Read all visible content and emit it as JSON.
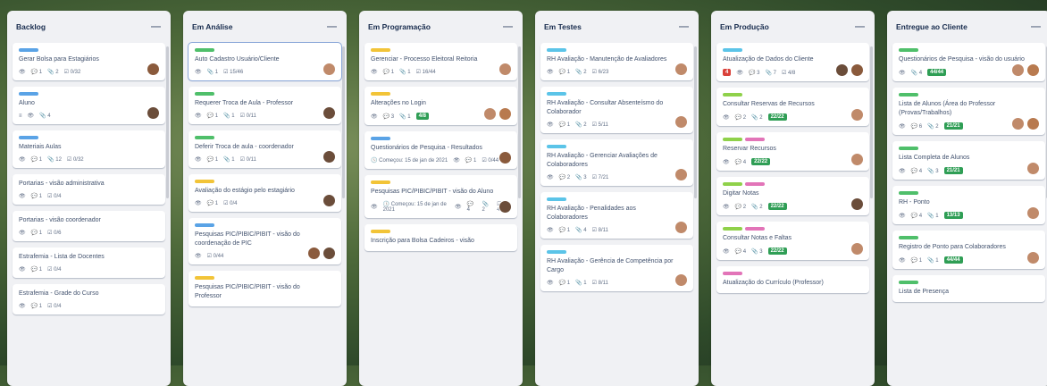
{
  "colors": {
    "blue": "#5aa3e6",
    "green": "#4fbf6a",
    "yellow": "#f2c438",
    "pink": "#e274b8",
    "sky": "#5bc4e8",
    "lime": "#8fd14a"
  },
  "columns": [
    {
      "title": "Backlog",
      "cards": [
        {
          "labels": [
            "blue"
          ],
          "title": "Gerar Bolsa para Estagiários",
          "badges": [
            "👁",
            "💬 1",
            "📎 2",
            "☑ 0/32"
          ],
          "avatars": [
            "a"
          ]
        },
        {
          "labels": [
            "blue"
          ],
          "title": "Aluno",
          "badges": [
            "≡",
            "👁",
            "📎 4"
          ],
          "avatars": [
            "c"
          ]
        },
        {
          "labels": [
            "blue"
          ],
          "title": "Materiais Aulas",
          "badges": [
            "👁",
            "💬 1",
            "📎 12",
            "☑ 0/32"
          ],
          "avatars": []
        },
        {
          "labels": [],
          "title": "Portarias - visão administrativa",
          "badges": [
            "👁",
            "💬 1",
            "☑ 0/4"
          ],
          "avatars": []
        },
        {
          "labels": [],
          "title": "Portarias - visão coordenador",
          "badges": [
            "👁",
            "💬 1",
            "☑ 0/6"
          ],
          "avatars": []
        },
        {
          "labels": [],
          "title": "Estrafemia - Lista de Docentes",
          "badges": [
            "👁",
            "💬 1",
            "☑ 0/4"
          ],
          "avatars": []
        },
        {
          "labels": [],
          "title": "Estrafemia - Grade do Curso",
          "badges": [
            "👁",
            "💬 1",
            "☑ 0/4"
          ],
          "avatars": []
        }
      ]
    },
    {
      "title": "Em Análise",
      "cards": [
        {
          "labels": [
            "green"
          ],
          "title": "Auto Cadastro Usuário/Cliente",
          "badges": [
            "👁",
            "📎 1",
            "☑ 15/46"
          ],
          "avatars": [
            "d"
          ],
          "sel": true
        },
        {
          "labels": [
            "green"
          ],
          "title": "Requerer Troca de Aula - Professor",
          "badges": [
            "👁",
            "💬 1",
            "📎 1",
            "☑ 0/11"
          ],
          "avatars": [
            "c"
          ]
        },
        {
          "labels": [
            "green"
          ],
          "title": "Deferir Troca de aula - coordenador",
          "badges": [
            "👁",
            "💬 1",
            "📎 1",
            "☑ 0/11"
          ],
          "avatars": [
            "c"
          ]
        },
        {
          "labels": [
            "yellow"
          ],
          "title": "Avaliação do estágio pelo estagiário",
          "badges": [
            "👁",
            "💬 1",
            "☑ 0/4"
          ],
          "avatars": [
            "c"
          ]
        },
        {
          "labels": [
            "blue"
          ],
          "title": "Pesquisas PIC/PIBIC/PIBIT - visão do coordenação de PIC",
          "badges": [
            "👁",
            "☑ 0/44"
          ],
          "avatars": [
            "a",
            "c"
          ]
        },
        {
          "labels": [
            "yellow"
          ],
          "title": "Pesquisas PIC/PIBIC/PIBIT - visão do Professor",
          "badges": [],
          "avatars": []
        }
      ]
    },
    {
      "title": "Em Programação",
      "cards": [
        {
          "labels": [
            "yellow"
          ],
          "title": "Gerenciar - Processo Eleitoral Reitoria",
          "badges": [
            "👁",
            "💬 1",
            "📎 1",
            "☑ 16/44"
          ],
          "avatars": [
            "d"
          ]
        },
        {
          "labels": [
            "yellow"
          ],
          "title": "Alterações no Login",
          "badges": [
            "👁",
            "💬 3",
            "📎 1"
          ],
          "due": "4/8",
          "avatars": [
            "d",
            "b"
          ]
        },
        {
          "labels": [
            "blue"
          ],
          "title": "Questionários de Pesquisa - Resultados",
          "badges": [
            "🕓 Começou: 15 de jan de 2021",
            "👁",
            "💬 1",
            "☑ 0/44"
          ],
          "avatars": [
            "a"
          ]
        },
        {
          "labels": [
            "yellow"
          ],
          "title": "Pesquisas PIC/PIBIC/PIBIT - visão do Aluno",
          "badges": [
            "👁",
            "🕓 Começou: 15 de jan de 2021",
            "👁",
            "💬 4",
            "📎 2",
            "☑ 4/11"
          ],
          "avatars": [
            "c"
          ]
        },
        {
          "labels": [
            "yellow"
          ],
          "title": "Inscrição para Bolsa Cadeiros - visão",
          "badges": [],
          "avatars": []
        }
      ]
    },
    {
      "title": "Em Testes",
      "cards": [
        {
          "labels": [
            "sky"
          ],
          "title": "RH Avaliação - Manutenção de Avaliadores",
          "badges": [
            "👁",
            "💬 1",
            "📎 2",
            "☑ 6/23"
          ],
          "avatars": [
            "d"
          ]
        },
        {
          "labels": [
            "sky"
          ],
          "title": "RH Avaliação - Consultar Absenteísmo do Colaborador",
          "badges": [
            "👁",
            "💬 1",
            "📎 2",
            "☑ 5/11"
          ],
          "avatars": [
            "d"
          ]
        },
        {
          "labels": [
            "sky"
          ],
          "title": "RH Avaliação - Gerenciar Avaliações de Colaboradores",
          "badges": [
            "👁",
            "💬 2",
            "📎 3",
            "☑ 7/21"
          ],
          "avatars": [
            "d"
          ]
        },
        {
          "labels": [
            "sky"
          ],
          "title": "RH Avaliação - Penalidades aos Colaboradores",
          "badges": [
            "👁",
            "💬 1",
            "📎 4",
            "☑ 8/11"
          ],
          "avatars": [
            "d"
          ]
        },
        {
          "labels": [
            "sky"
          ],
          "title": "RH Avaliação - Gerência de Competência por Cargo",
          "badges": [
            "👁",
            "💬 1",
            "📎 1",
            "☑ 8/11"
          ],
          "avatars": [
            "d"
          ]
        }
      ]
    },
    {
      "title": "Em Produção",
      "cards": [
        {
          "labels": [
            "sky"
          ],
          "title": "Atualização de Dados do Cliente",
          "badges": [
            "👁",
            "💬 3",
            "📎 7",
            "☑ 4/8"
          ],
          "due": "4",
          "dueRed": true,
          "avatars": [
            "c",
            "a"
          ]
        },
        {
          "labels": [
            "lime"
          ],
          "title": "Consultar Reservas de Recursos",
          "badges": [
            "👁",
            "💬 2",
            "📎 2"
          ],
          "due": "22/22",
          "avatars": [
            "d"
          ]
        },
        {
          "labels": [
            "lime",
            "pink"
          ],
          "title": "Reservar Recursos",
          "badges": [
            "👁",
            "💬 4"
          ],
          "due": "22/22",
          "avatars": [
            "d"
          ]
        },
        {
          "labels": [
            "lime",
            "pink"
          ],
          "title": "Digitar Notas",
          "badges": [
            "👁",
            "💬 2",
            "📎 2"
          ],
          "due": "22/22",
          "avatars": [
            "c"
          ]
        },
        {
          "labels": [
            "lime",
            "pink"
          ],
          "title": "Consultar Notas e Faltas",
          "badges": [
            "👁",
            "💬 4",
            "📎 3"
          ],
          "due": "22/22",
          "avatars": [
            "d"
          ]
        },
        {
          "labels": [
            "pink"
          ],
          "title": "Atualização do Currículo (Professor)",
          "badges": [],
          "avatars": []
        }
      ]
    },
    {
      "title": "Entregue ao Cliente",
      "cards": [
        {
          "labels": [
            "green"
          ],
          "title": "Questionários de Pesquisa - visão do usuário",
          "badges": [
            "👁",
            "📎 4"
          ],
          "due": "44/44",
          "avatars": [
            "d",
            "b"
          ]
        },
        {
          "labels": [
            "green"
          ],
          "title": "Lista de Alunos (Área do Professor (Provas/Trabalhos)",
          "badges": [
            "👁",
            "💬 6",
            "📎 2"
          ],
          "due": "21/21",
          "avatars": [
            "d",
            "b"
          ]
        },
        {
          "labels": [
            "green"
          ],
          "title": "Lista Completa de Alunos",
          "badges": [
            "👁",
            "💬 4",
            "📎 3"
          ],
          "due": "21/21",
          "avatars": [
            "d"
          ]
        },
        {
          "labels": [
            "green"
          ],
          "title": "RH - Ponto",
          "badges": [
            "👁",
            "💬 4",
            "📎 1"
          ],
          "due": "13/13",
          "avatars": [
            "d"
          ]
        },
        {
          "labels": [
            "green"
          ],
          "title": "Registro de Ponto para Colaboradores",
          "badges": [
            "👁",
            "💬 1",
            "📎 1"
          ],
          "due": "44/44",
          "avatars": [
            "d"
          ]
        },
        {
          "labels": [
            "green"
          ],
          "title": "Lista de Presença",
          "badges": [],
          "avatars": []
        }
      ]
    }
  ]
}
